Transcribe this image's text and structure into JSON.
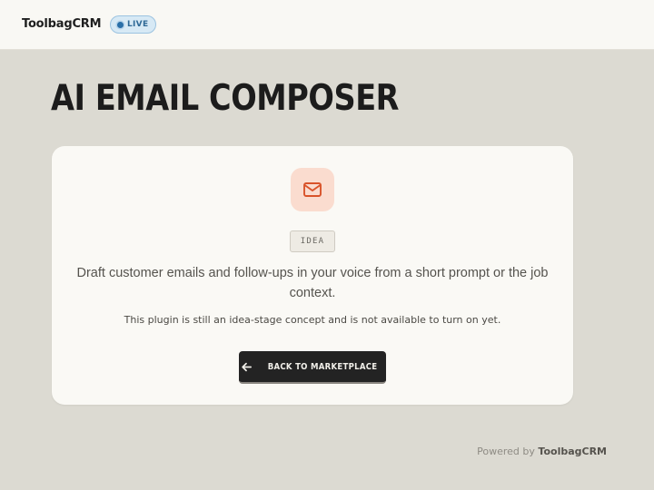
{
  "header": {
    "brand": "ToolbagCRM",
    "status_badge": "LIVE"
  },
  "page": {
    "title": "AI EMAIL COMPOSER"
  },
  "plugin_card": {
    "icon": "mail-icon",
    "stage_badge": "IDEA",
    "description": "Draft customer emails and follow-ups in your voice from a short prompt or the job context.",
    "notice": "This plugin is still an idea-stage concept and is not available to turn on yet.",
    "back_button": {
      "icon": "arrow-left-icon",
      "label": "BACK TO MARKETPLACE"
    }
  },
  "footer": {
    "powered_prefix": "Powered by",
    "powered_brand": "ToolbagCRM"
  },
  "colors": {
    "accent_orange": "#d9532a",
    "icon_tile_bg": "#fadccf",
    "live_blue": "#2a6fa8",
    "button_dark": "#232323",
    "page_bg": "#dcdad2"
  }
}
